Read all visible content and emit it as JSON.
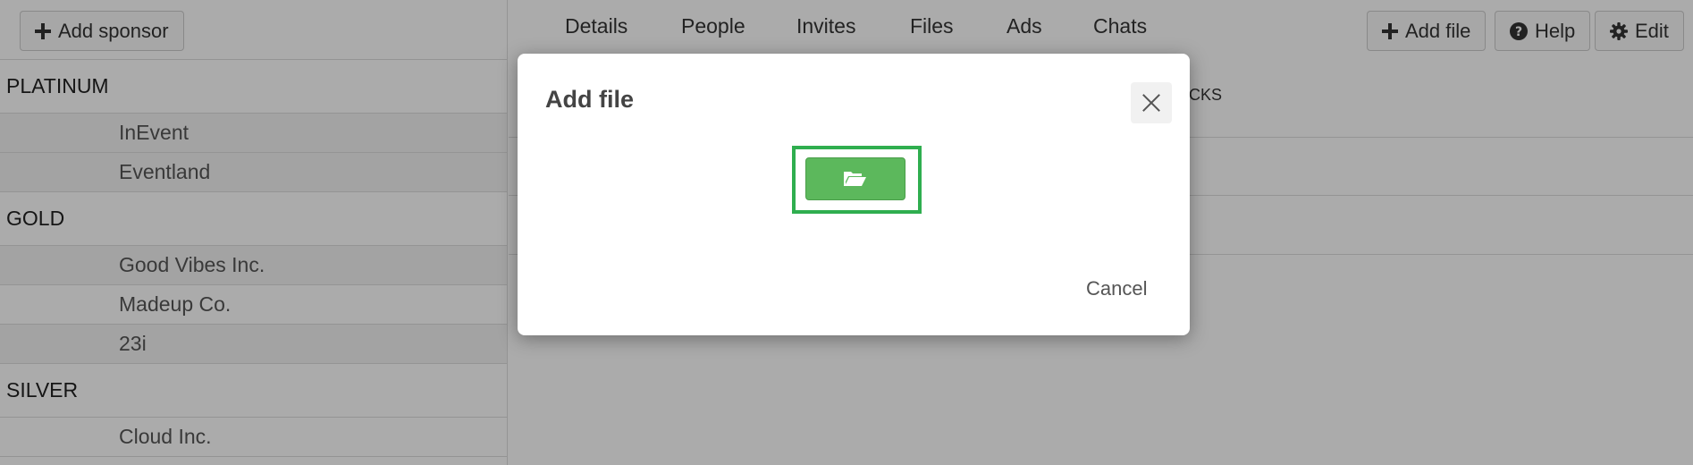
{
  "sponsors_panel": {
    "add_button_label": "Add sponsor",
    "groups": [
      {
        "name": "PLATINUM",
        "items": [
          "InEvent",
          "Eventland"
        ]
      },
      {
        "name": "GOLD",
        "items": [
          "Good Vibes Inc.",
          "Madeup Co.",
          "23i"
        ]
      },
      {
        "name": "SILVER",
        "items": [
          "Cloud Inc."
        ]
      }
    ]
  },
  "tabs": [
    "Details",
    "People",
    "Invites",
    "Files",
    "Ads",
    "Chats"
  ],
  "toolbar": {
    "add_file_label": "Add file",
    "help_label": "Help",
    "edit_label": "Edit"
  },
  "background_fragment": "CKS",
  "modal": {
    "title": "Add file",
    "cancel_label": "Cancel"
  },
  "colors": {
    "upload_button": "#5cb85c",
    "highlight_frame": "#2fae4f",
    "overlay": "rgba(0,0,0,0.33)"
  },
  "icons": {
    "upload_button": "folder-open-icon",
    "close": "close-icon"
  }
}
